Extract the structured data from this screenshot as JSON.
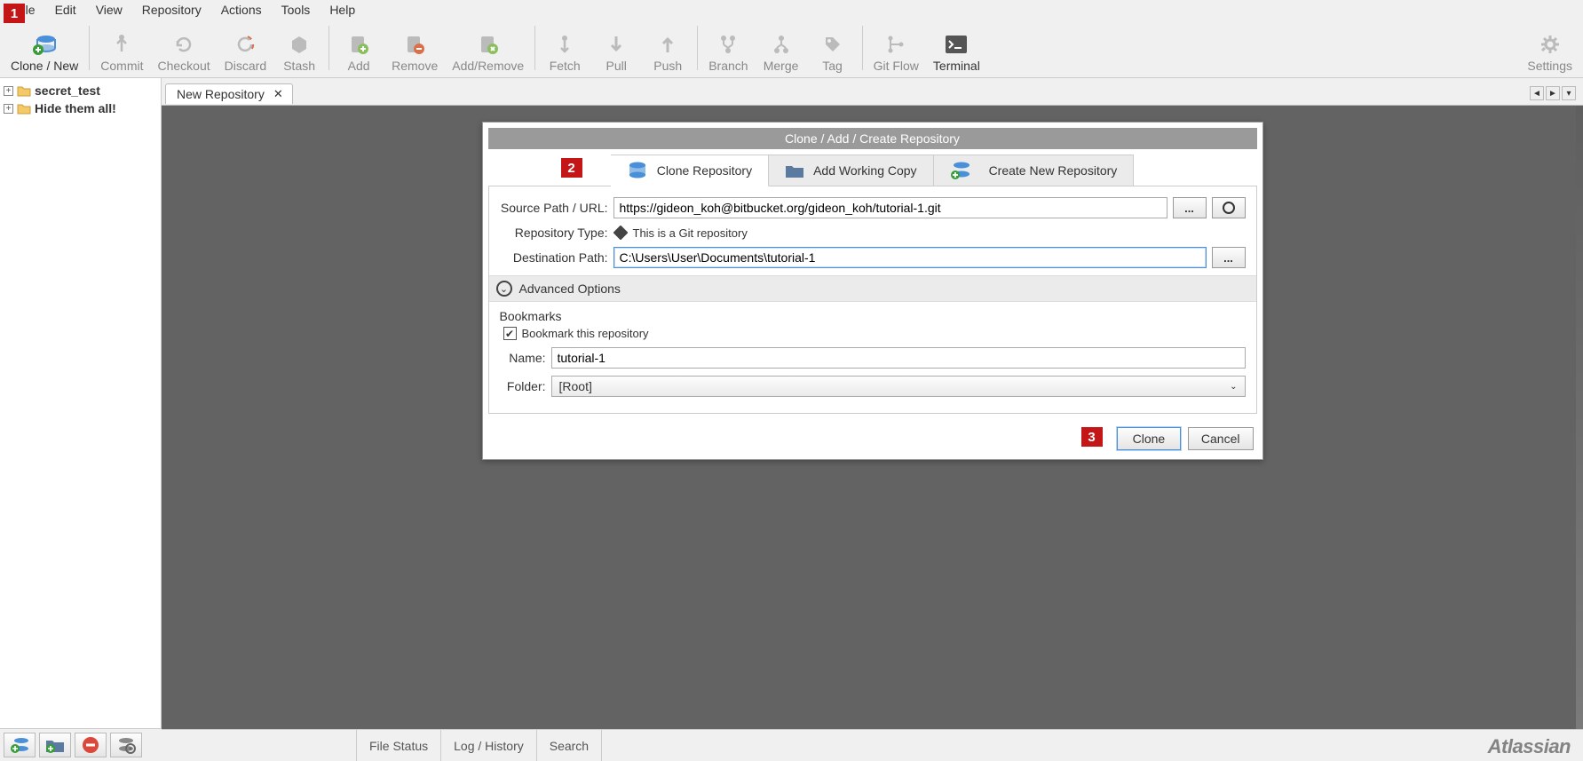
{
  "menu": [
    "File",
    "Edit",
    "View",
    "Repository",
    "Actions",
    "Tools",
    "Help"
  ],
  "toolbar": {
    "clone_new": "Clone / New",
    "commit": "Commit",
    "checkout": "Checkout",
    "discard": "Discard",
    "stash": "Stash",
    "add": "Add",
    "remove": "Remove",
    "add_remove": "Add/Remove",
    "fetch": "Fetch",
    "pull": "Pull",
    "push": "Push",
    "branch": "Branch",
    "merge": "Merge",
    "tag": "Tag",
    "gitflow": "Git Flow",
    "terminal": "Terminal",
    "settings": "Settings"
  },
  "marks": {
    "m1": "1",
    "m2": "2",
    "m3": "3"
  },
  "sidebar": {
    "items": [
      {
        "label": "secret_test"
      },
      {
        "label": "Hide them all!"
      }
    ]
  },
  "tabs": {
    "active": "New Repository"
  },
  "dialog": {
    "title": "Clone  / Add / Create Repository",
    "tabs": {
      "clone": "Clone Repository",
      "addwc": "Add Working Copy",
      "create": "Create New Repository"
    },
    "source_label": "Source Path / URL:",
    "source_value": "https://gideon_koh@bitbucket.org/gideon_koh/tutorial-1.git",
    "browse": "...",
    "repo_type_label": "Repository Type:",
    "repo_type_value": "This is a Git repository",
    "dest_label": "Destination Path:",
    "dest_value": "C:\\Users\\User\\Documents\\tutorial-1",
    "advanced": "Advanced Options",
    "bookmarks_section": "Bookmarks",
    "bookmark_check": "Bookmark this repository",
    "name_label": "Name:",
    "name_value": "tutorial-1",
    "folder_label": "Folder:",
    "folder_value": "[Root]",
    "clone_btn": "Clone",
    "cancel_btn": "Cancel"
  },
  "status": {
    "file_status": "File Status",
    "log_history": "Log / History",
    "search": "Search"
  },
  "brand": "Atlassian"
}
